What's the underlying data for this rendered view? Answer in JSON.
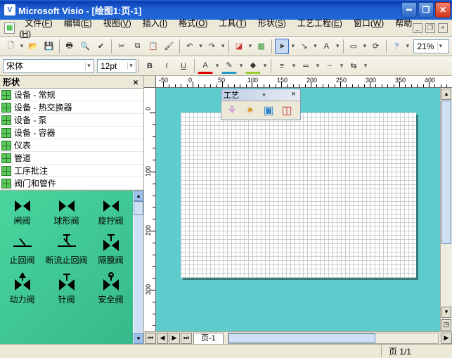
{
  "title": "Microsoft Visio - [绘图1:页-1]",
  "menus": [
    {
      "label": "文件",
      "u": "F"
    },
    {
      "label": "编辑",
      "u": "E"
    },
    {
      "label": "视图",
      "u": "V"
    },
    {
      "label": "插入",
      "u": "I"
    },
    {
      "label": "格式",
      "u": "O"
    },
    {
      "label": "工具",
      "u": "T"
    },
    {
      "label": "形状",
      "u": "S"
    },
    {
      "label": "工艺工程",
      "u": "E"
    },
    {
      "label": "窗口",
      "u": "W"
    },
    {
      "label": "帮助",
      "u": "H"
    }
  ],
  "font_name": "宋体",
  "font_size": "12pt",
  "zoom": "21%",
  "shapes_panel_title": "形状",
  "stencils": [
    "设备 - 常规",
    "设备 - 热交换器",
    "设备 - 泵",
    "设备 - 容器",
    "仪表",
    "管道",
    "工序批注",
    "阀门和管件"
  ],
  "shape_cells": [
    "闸阀",
    "球形阀",
    "旋拧阀",
    "止回阀",
    "断流止回阀",
    "隔膜阀",
    "动力阀",
    "针阀",
    "安全阀"
  ],
  "float_title": "工艺",
  "page_tab": "页-1",
  "status_page": "页 1/1",
  "ruler_h": [
    "-50",
    "0",
    "50",
    "100",
    "150",
    "200",
    "250",
    "300",
    "350",
    "400"
  ],
  "ruler_v": [
    "0",
    "100",
    "200",
    "300"
  ]
}
